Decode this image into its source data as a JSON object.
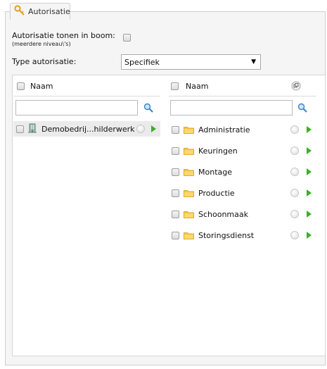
{
  "tab": {
    "label": "Autorisatie",
    "icon": "key-icon"
  },
  "options": {
    "show_in_tree_label": "Autorisatie tonen in boom:",
    "show_in_tree_sub": "(meerdere niveau\\'s)",
    "show_in_tree_checked": false,
    "type_label": "Type autorisatie:",
    "type_value": "Specifiek"
  },
  "left_list": {
    "header": "Naam",
    "search_placeholder": "",
    "items": [
      {
        "label": "Demobedrij...hilderwerk",
        "icon": "building-icon",
        "selected": true
      }
    ]
  },
  "right_list": {
    "header": "Naam",
    "header_icon": "copy-icon",
    "search_placeholder": "",
    "items": [
      {
        "label": "Administratie",
        "icon": "folder-icon"
      },
      {
        "label": "Keuringen",
        "icon": "folder-icon"
      },
      {
        "label": "Montage",
        "icon": "folder-icon"
      },
      {
        "label": "Productie",
        "icon": "folder-icon"
      },
      {
        "label": "Schoonmaak",
        "icon": "folder-icon"
      },
      {
        "label": "Storingsdienst",
        "icon": "folder-icon"
      }
    ]
  },
  "colors": {
    "accent_green": "#3fae2a",
    "folder": "#f5c542",
    "panel_bg": "#f5f5f5"
  }
}
